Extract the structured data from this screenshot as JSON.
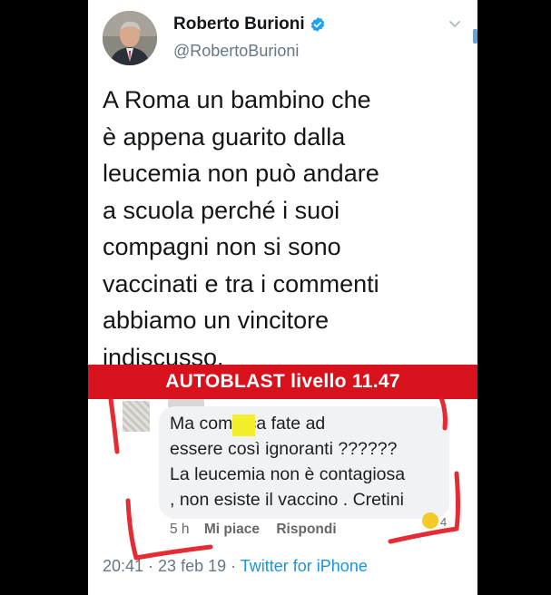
{
  "tweet": {
    "display_name": "Roberto Burioni",
    "handle": "@RobertoBurioni",
    "text": "A Roma un bambino che\nè appena guarito dalla\nleucemia non può andare\na scuola perché i suoi\ncompagni non si sono\nvaccinati e tra i commenti\nabbiamo un vincitore\nindiscusso.",
    "timestamp": "20:41 · 23 feb 19",
    "separator": " · ",
    "source": "Twitter for iPhone"
  },
  "banner": {
    "text": "AUTOBLAST livello 11.47"
  },
  "comment": {
    "text": "Ma come ca      fate ad\nessere così ignoranti ??????\nLa leucemia non è contagiosa\n, non esiste il vaccino . Cretini",
    "time": "5 h",
    "like_label": "Mi piace",
    "reply_label": "Rispondi",
    "reaction_count": "4"
  },
  "colors": {
    "banner": "#d8121d",
    "link": "#1b95e0",
    "censor": "#f4ef2c",
    "annotation": "#e1151f"
  }
}
